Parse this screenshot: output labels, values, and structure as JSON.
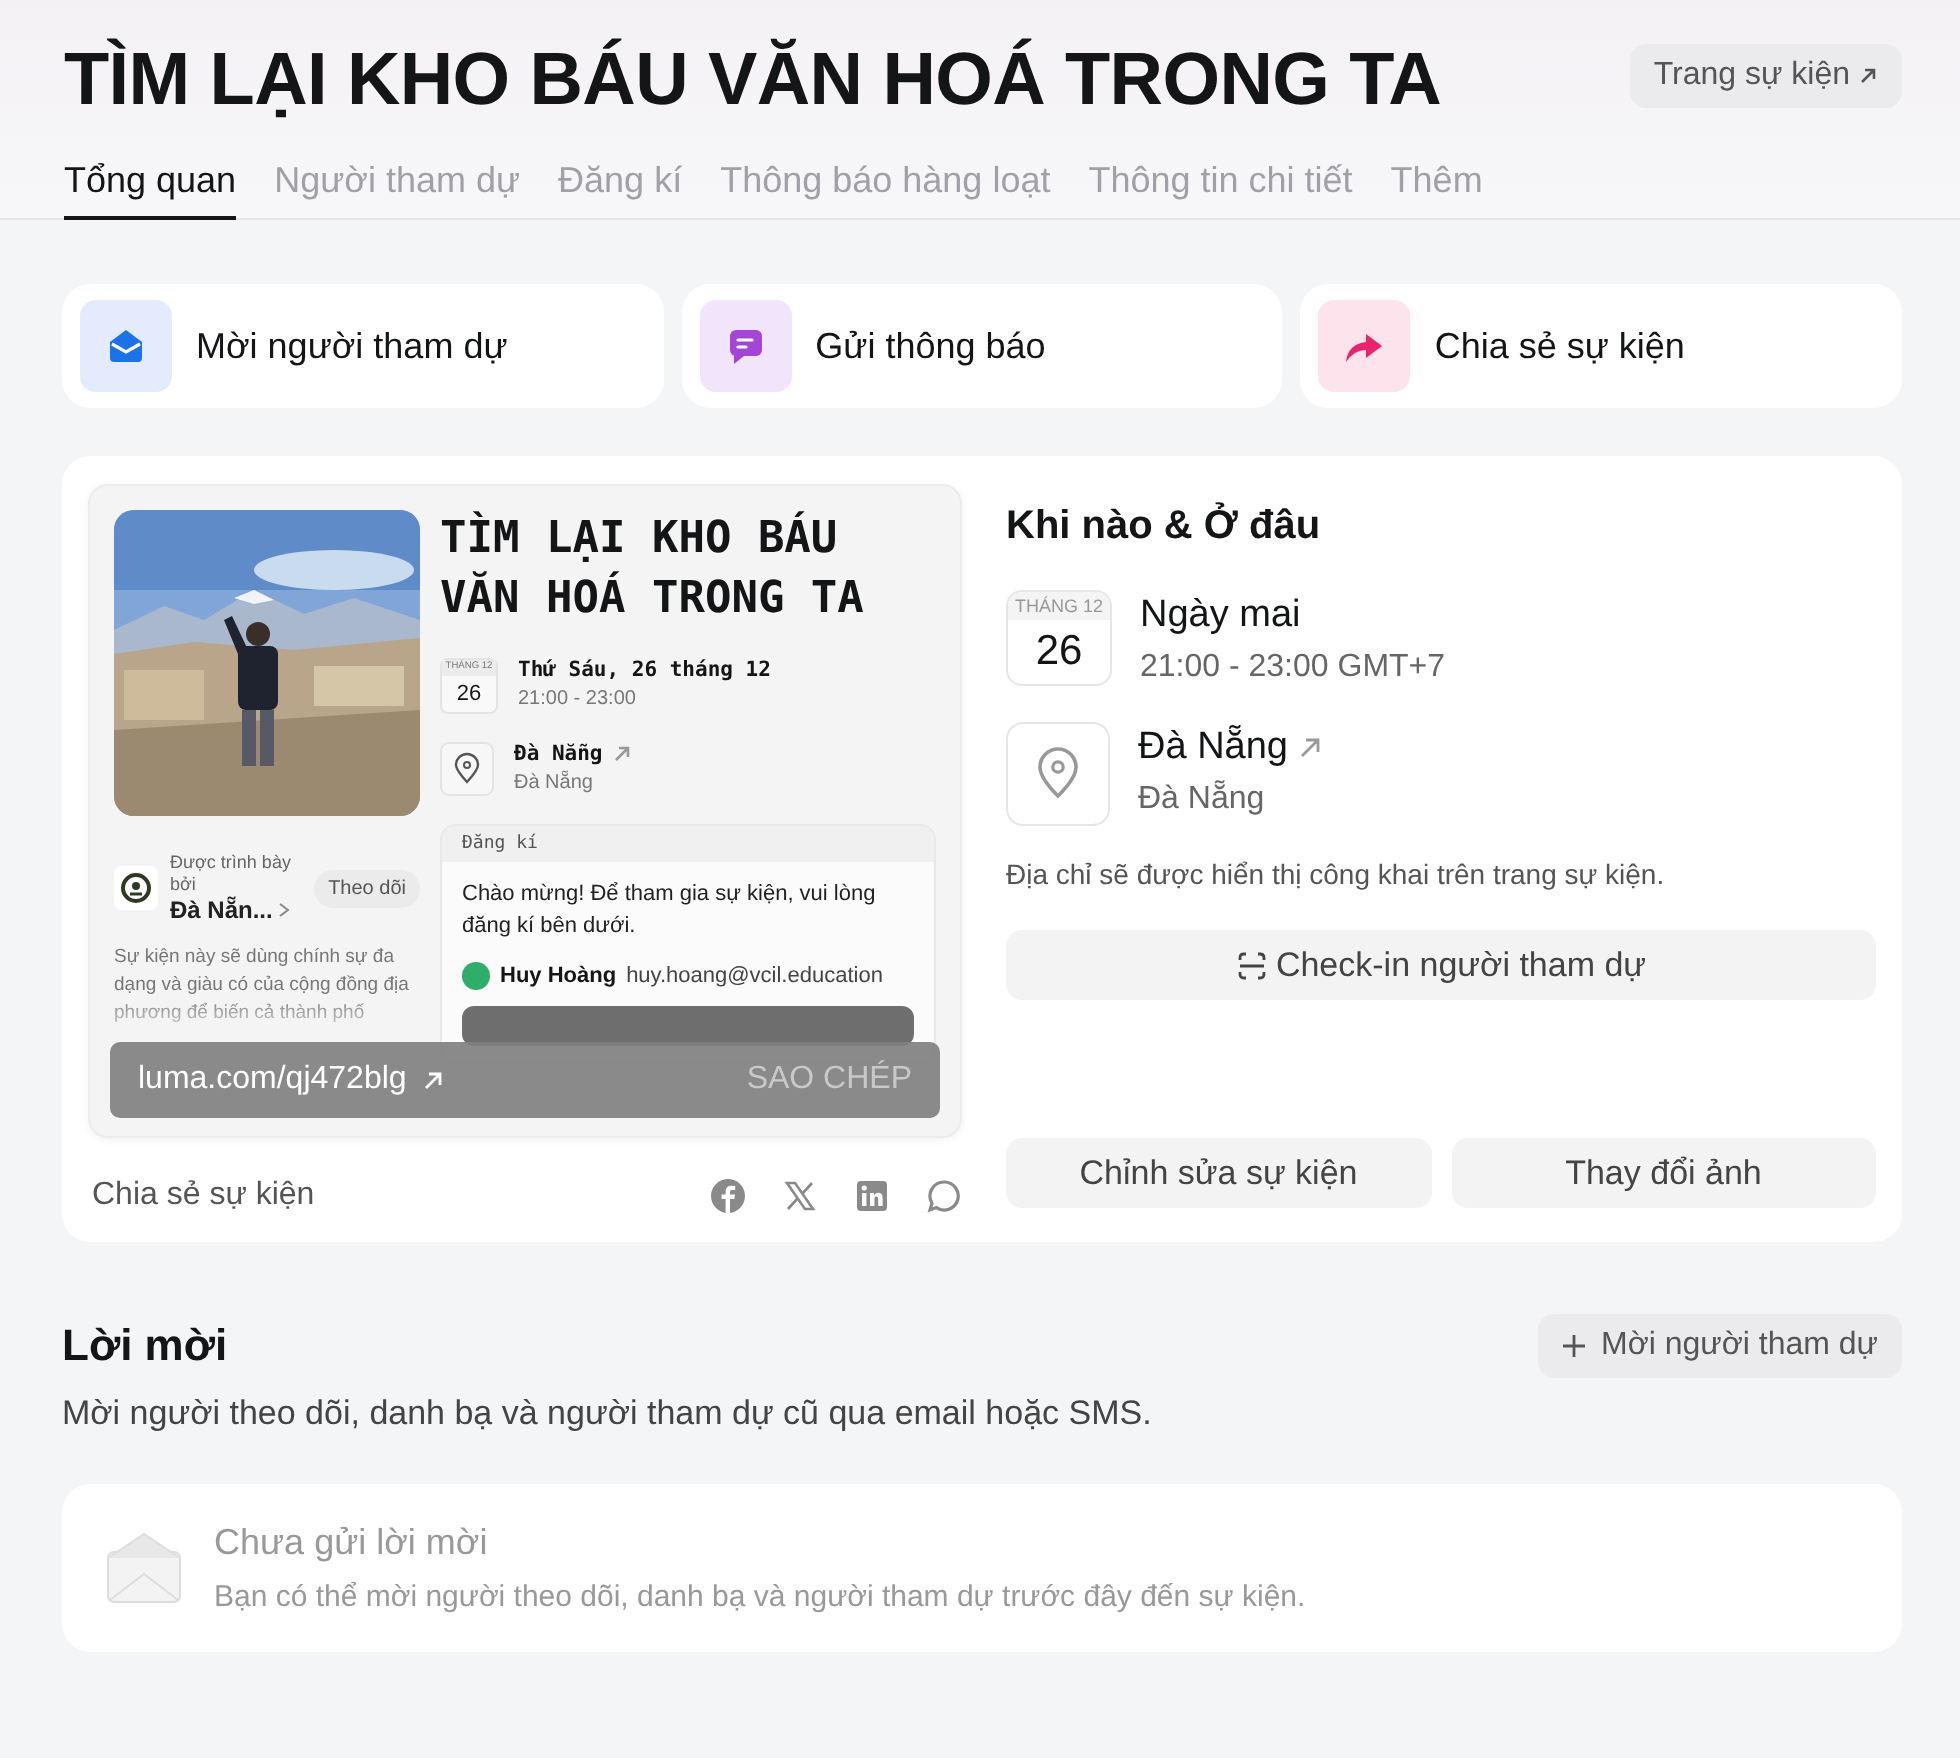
{
  "header": {
    "title": "TÌM LẠI KHO BÁU VĂN HOÁ TRONG TA",
    "event_page_button": "Trang sự kiện"
  },
  "tabs": [
    {
      "label": "Tổng quan",
      "selected": true
    },
    {
      "label": "Người tham dự",
      "selected": false
    },
    {
      "label": "Đăng kí",
      "selected": false
    },
    {
      "label": "Thông báo hàng loạt",
      "selected": false
    },
    {
      "label": "Thông tin chi tiết",
      "selected": false
    },
    {
      "label": "Thêm",
      "selected": false
    }
  ],
  "quick_actions": [
    {
      "label": "Mời người tham dự",
      "kind": "invite"
    },
    {
      "label": "Gửi thông báo",
      "kind": "notify"
    },
    {
      "label": "Chia sẻ sự kiện",
      "kind": "share"
    }
  ],
  "preview": {
    "title": "TÌM LẠI KHO BÁU VĂN HOÁ TRONG TA",
    "month": "THÁNG 12",
    "day": "26",
    "date": "Thứ Sáu, 26 tháng 12",
    "time": "21:00 - 23:00",
    "venue": "Đà Nẵng",
    "venue_sub": "Đà Nẵng",
    "host_label": "Được trình bày bởi",
    "host_name": "Đà Nẵn...",
    "follow_button": "Theo dõi",
    "description": "Sự kiện này sẽ dùng chính sự đa dạng và giàu có của cộng đồng địa phương để biến cả thành phố",
    "registration": {
      "header": "Đăng kí",
      "message": "Chào mừng! Để tham gia sự kiện, vui lòng đăng kí bên dưới.",
      "user_name": "Huy Hoàng",
      "user_email": "huy.hoang@vcil.education"
    },
    "link": "luma.com/qj472blg",
    "copy_button": "SAO CHÉP"
  },
  "share": {
    "label": "Chia sẻ sự kiện",
    "networks": [
      {
        "kind": "facebook"
      },
      {
        "kind": "x"
      },
      {
        "kind": "linkedin"
      },
      {
        "kind": "chat"
      }
    ]
  },
  "when_where": {
    "title": "Khi nào & Ở đâu",
    "month": "THÁNG 12",
    "day": "26",
    "date_title": "Ngày mai",
    "time": "21:00 - 23:00 GMT+7",
    "location": "Đà Nẵng",
    "location_sub": "Đà Nẵng",
    "note": "Địa chỉ sẽ được hiển thị công khai trên trang sự kiện.",
    "checkin_button": "Check-in người tham dự"
  },
  "buttons": [
    "Chỉnh sửa sự kiện",
    "Thay đổi ảnh"
  ],
  "invites": {
    "title": "Lời mời",
    "add_button": "Mời người tham dự",
    "description": "Mời người theo dõi, danh bạ và người tham dự cũ qua email hoặc SMS.",
    "empty_title": "Chưa gửi lời mời",
    "empty_text": "Bạn có thể mời người theo dõi, danh bạ và người tham dự trước đây đến sự kiện."
  }
}
